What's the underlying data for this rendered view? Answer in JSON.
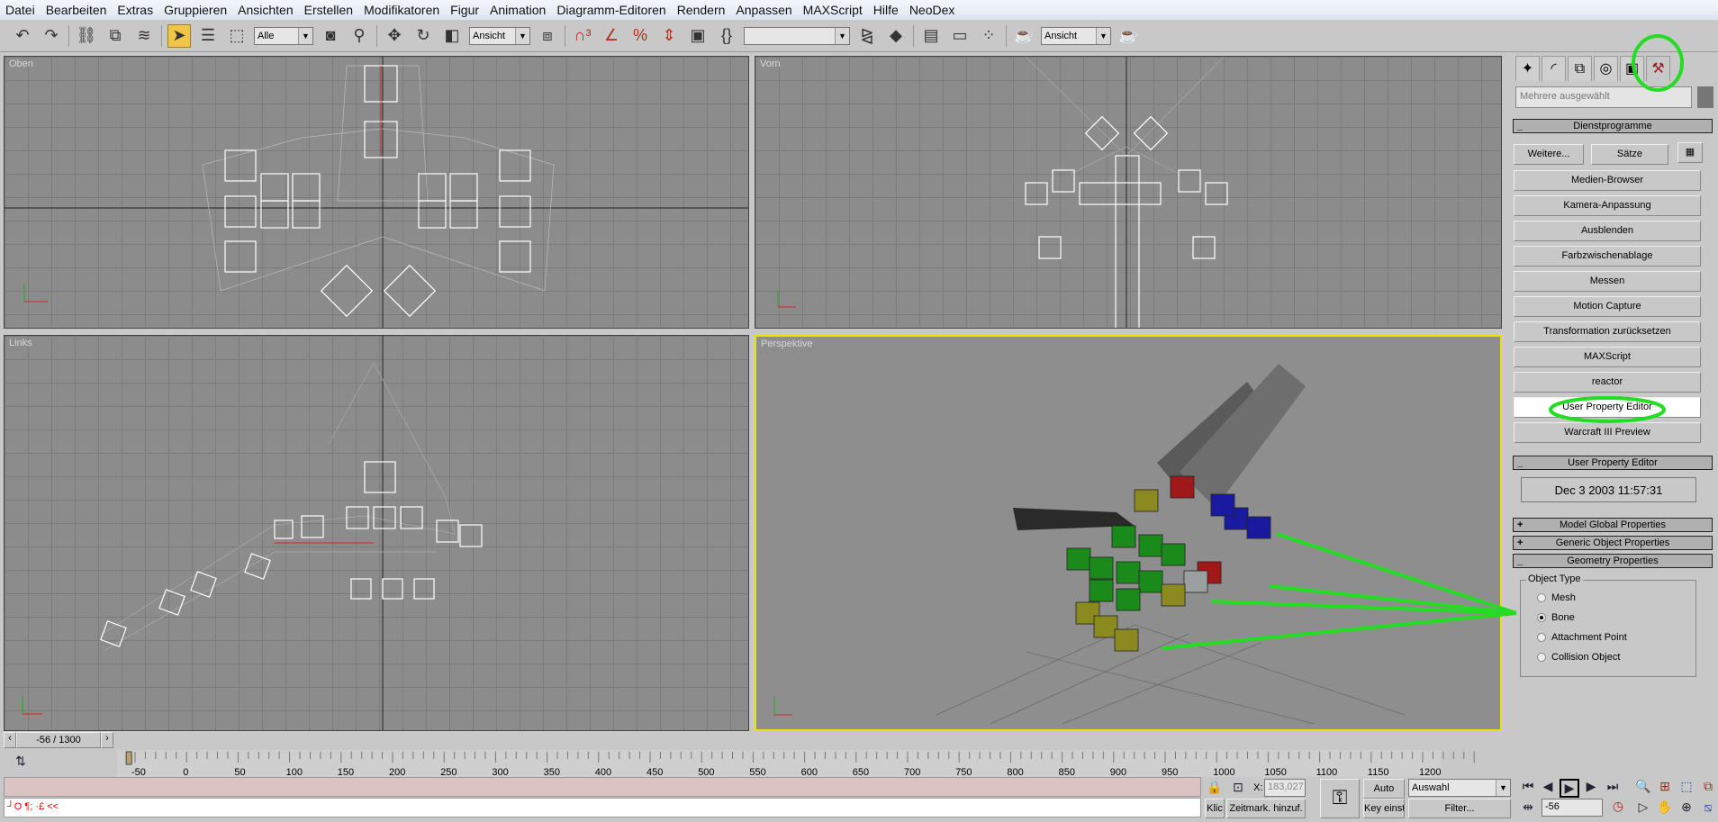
{
  "menu": [
    "Datei",
    "Bearbeiten",
    "Extras",
    "Gruppieren",
    "Ansichten",
    "Erstellen",
    "Modifikatoren",
    "Figur",
    "Animation",
    "Diagramm-Editoren",
    "Rendern",
    "Anpassen",
    "MAXScript",
    "Hilfe",
    "NeoDex"
  ],
  "toolbar": {
    "selection_filter": "Alle",
    "ref_coord": "Ansicht",
    "named_selection": "",
    "render_view": "Ansicht"
  },
  "viewports": {
    "top": "Oben",
    "front": "Vorn",
    "left": "Links",
    "perspective": "Perspektive"
  },
  "panel": {
    "name_field": "Mehrere ausgewählt",
    "utilities_rollout": "Dienstprogramme",
    "more_button": "Weitere...",
    "sets_button": "Sätze",
    "utilities": [
      "Medien-Browser",
      "Kamera-Anpassung",
      "Ausblenden",
      "Farbzwischenablage",
      "Messen",
      "Motion Capture",
      "Transformation zurücksetzen",
      "MAXScript",
      "reactor",
      "User Property Editor",
      "Warcraft III Preview"
    ],
    "selected_utility": "User Property Editor",
    "upe_rollout": "User Property Editor",
    "upe_date": "Dec  3 2003 11:57:31",
    "model_global": "Model Global Properties",
    "generic_object": "Generic Object Properties",
    "geometry": "Geometry Properties",
    "object_type_label": "Object Type",
    "object_types": [
      "Mesh",
      "Bone",
      "Attachment Point",
      "Collision Object"
    ],
    "selected_object_type": "Bone"
  },
  "time_slider": {
    "label": "-56 / 1300",
    "current": -56,
    "total": 1300
  },
  "timeline_ticks": [
    "-50",
    "0",
    "50",
    "100",
    "150",
    "200",
    "250",
    "300",
    "350",
    "400",
    "450",
    "500",
    "550",
    "600",
    "650",
    "700",
    "750",
    "800",
    "850",
    "900",
    "950",
    "1000",
    "1050",
    "1100",
    "1150",
    "1200"
  ],
  "command_line": "┘O ¶; ·£ <<",
  "status": {
    "klick": "Klic",
    "add_time_tag": "Zeitmark. hinzuf.",
    "x_label": "X:",
    "x_value": "183,027",
    "auto": "Auto",
    "set_key": "Key einstellen",
    "key_filter": "Auswahl",
    "filter_button": "Filter...",
    "frame": "-56"
  },
  "colors": {
    "annotation": "#22dd22",
    "active_viewport": "#f0e000",
    "tool_active": "#f0c64a"
  }
}
